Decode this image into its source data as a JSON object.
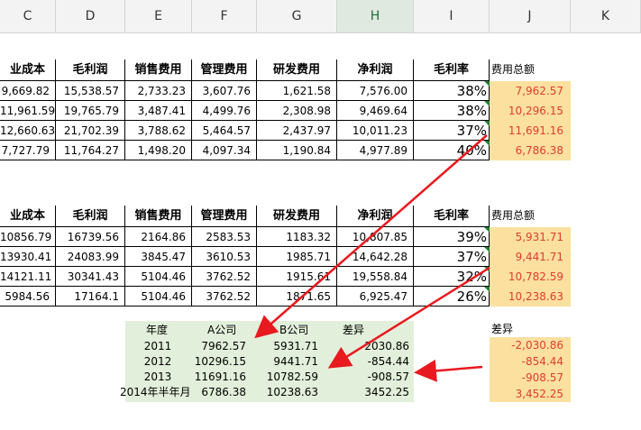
{
  "columns": [
    "C",
    "D",
    "E",
    "F",
    "G",
    "H",
    "I",
    "J",
    "K"
  ],
  "table1": {
    "headers": [
      "业成本",
      "毛利润",
      "销售费用",
      "管理费用",
      "研发费用",
      "净利润",
      "毛利率"
    ],
    "rows": [
      [
        "9,669.82",
        "15,538.57",
        "2,733.23",
        "3,607.76",
        "1,621.58",
        "7,576.00",
        "38%"
      ],
      [
        "11,961.59",
        "19,765.79",
        "3,487.41",
        "4,499.76",
        "2,308.98",
        "9,469.64",
        "38%"
      ],
      [
        "12,660.63",
        "21,702.39",
        "3,788.62",
        "5,464.57",
        "2,437.97",
        "10,011.23",
        "37%"
      ],
      [
        "7,727.79",
        "11,764.27",
        "1,498.20",
        "4,097.34",
        "1,190.84",
        "4,977.89",
        "40%"
      ]
    ],
    "total_label": "费用总额",
    "totals": [
      "7,962.57",
      "10,296.15",
      "11,691.16",
      "6,786.38"
    ]
  },
  "table2": {
    "headers": [
      "业成本",
      "毛利润",
      "销售费用",
      "管理费用",
      "研发费用",
      "净利润",
      "毛利率"
    ],
    "rows": [
      [
        "10856.79",
        "16739.56",
        "2164.86",
        "2583.53",
        "1183.32",
        "10,807.85",
        "39%"
      ],
      [
        "13930.41",
        "24083.99",
        "3845.47",
        "3610.53",
        "1985.71",
        "14,642.28",
        "37%"
      ],
      [
        "14121.11",
        "30341.43",
        "5104.46",
        "3762.52",
        "1915.61",
        "19,558.84",
        "32%"
      ],
      [
        "5984.56",
        "17164.1",
        "5104.46",
        "3762.52",
        "1871.65",
        "6,925.47",
        "26%"
      ]
    ],
    "total_label": "费用总额",
    "totals": [
      "5,931.71",
      "9,441.71",
      "10,782.59",
      "10,238.63"
    ]
  },
  "comparison": {
    "headers": [
      "年度",
      "A公司",
      "B公司",
      "差异"
    ],
    "rows": [
      [
        "2011",
        "7962.57",
        "5931.71",
        "2030.86"
      ],
      [
        "2012",
        "10296.15",
        "9441.71",
        "-854.44"
      ],
      [
        "2013",
        "11691.16",
        "10782.59",
        "-908.57"
      ],
      [
        "2014年半年月",
        "6786.38",
        "10238.63",
        "3452.25"
      ]
    ]
  },
  "diff": {
    "label": "差异",
    "values": [
      "-2,030.86",
      "-854.44",
      "-908.57",
      "3,452.25"
    ]
  },
  "colors": {
    "highlight_fill": "#fbe0a0",
    "red_text": "#e03c31",
    "green_fill": "#e2efda",
    "arrow": "#e8191f"
  }
}
